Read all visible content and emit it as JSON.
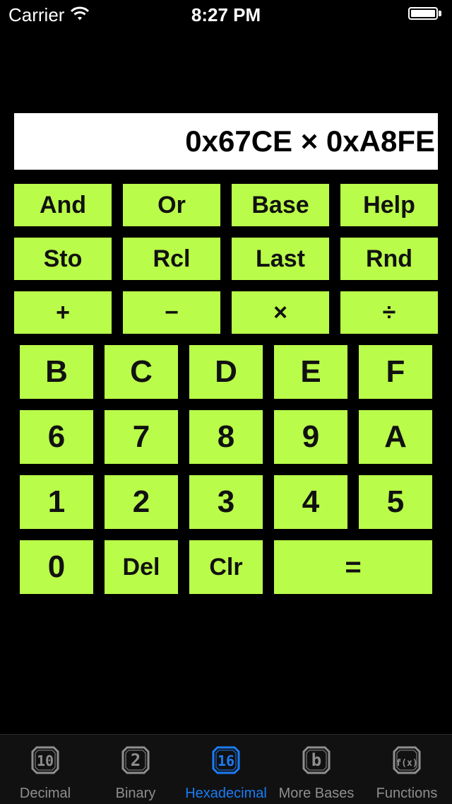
{
  "status_bar": {
    "carrier": "Carrier",
    "time": "8:27 PM"
  },
  "display": {
    "expression": "0x67CE × 0xA8FE"
  },
  "function_keys": [
    {
      "name": "and-key",
      "label": "And"
    },
    {
      "name": "or-key",
      "label": "Or"
    },
    {
      "name": "base-key",
      "label": "Base"
    },
    {
      "name": "help-key",
      "label": "Help"
    },
    {
      "name": "store-key",
      "label": "Sto"
    },
    {
      "name": "recall-key",
      "label": "Rcl"
    },
    {
      "name": "last-key",
      "label": "Last"
    },
    {
      "name": "random-key",
      "label": "Rnd"
    },
    {
      "name": "add-key",
      "label": "+"
    },
    {
      "name": "subtract-key",
      "label": "−"
    },
    {
      "name": "multiply-key",
      "label": "×"
    },
    {
      "name": "divide-key",
      "label": "÷"
    }
  ],
  "digit_keys": [
    {
      "name": "digit-b-key",
      "label": "B"
    },
    {
      "name": "digit-c-key",
      "label": "C"
    },
    {
      "name": "digit-d-key",
      "label": "D"
    },
    {
      "name": "digit-e-key",
      "label": "E"
    },
    {
      "name": "digit-f-key",
      "label": "F"
    },
    {
      "name": "digit-6-key",
      "label": "6"
    },
    {
      "name": "digit-7-key",
      "label": "7"
    },
    {
      "name": "digit-8-key",
      "label": "8"
    },
    {
      "name": "digit-9-key",
      "label": "9"
    },
    {
      "name": "digit-a-key",
      "label": "A"
    },
    {
      "name": "digit-1-key",
      "label": "1"
    },
    {
      "name": "digit-2-key",
      "label": "2"
    },
    {
      "name": "digit-3-key",
      "label": "3"
    },
    {
      "name": "digit-4-key",
      "label": "4"
    },
    {
      "name": "digit-5-key",
      "label": "5"
    },
    {
      "name": "digit-0-key",
      "label": "0"
    },
    {
      "name": "delete-key",
      "label": "Del"
    },
    {
      "name": "clear-key",
      "label": "Clr"
    },
    {
      "name": "equals-key",
      "label": "="
    }
  ],
  "tabs": [
    {
      "name": "tab-decimal",
      "icon": "decimal-10-icon",
      "glyph": "10",
      "label": "Decimal",
      "active": false
    },
    {
      "name": "tab-binary",
      "icon": "binary-2-icon",
      "glyph": "2",
      "label": "Binary",
      "active": false
    },
    {
      "name": "tab-hexadecimal",
      "icon": "hexadecimal-16-icon",
      "glyph": "16",
      "label": "Hexadecimal",
      "active": true
    },
    {
      "name": "tab-more-bases",
      "icon": "more-bases-b-icon",
      "glyph": "b",
      "label": "More Bases",
      "active": false
    },
    {
      "name": "tab-functions",
      "icon": "functions-fx-icon",
      "glyph": "f(x)",
      "label": "Functions",
      "active": false
    }
  ],
  "colors": {
    "key_background": "#b9fc4a",
    "key_text": "#111111",
    "active_tab": "#1a7cf5",
    "inactive_tab": "#8e8e8e"
  }
}
